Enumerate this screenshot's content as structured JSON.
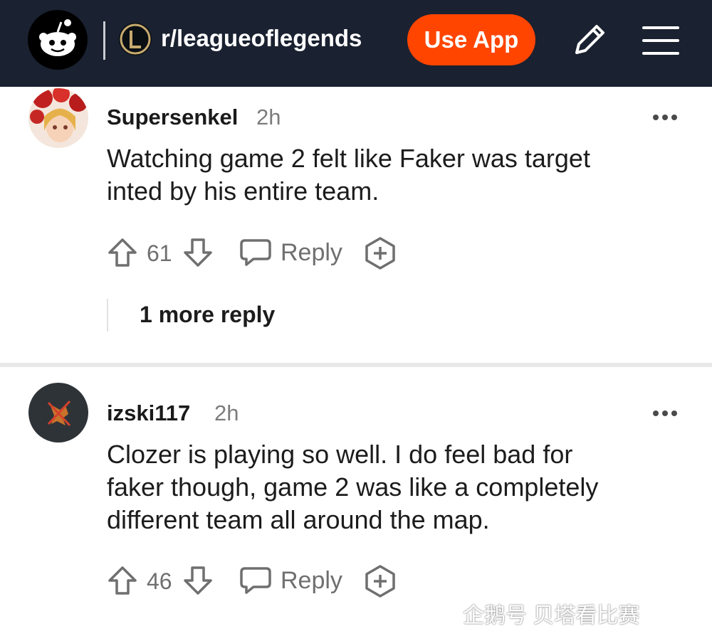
{
  "header": {
    "subreddit": "r/leagueoflegends",
    "use_app_label": "Use App",
    "icons": [
      "reddit-logo-icon",
      "league-logo-icon",
      "pencil-icon",
      "menu-icon"
    ]
  },
  "comments": [
    {
      "username": "Supersenkel",
      "time": "2h",
      "text_line1": "Watching game 2 felt like Faker was target",
      "text_line2": "inted by his entire team.",
      "score": "61",
      "reply_label": "Reply",
      "more_replies": "1 more reply"
    },
    {
      "username": "izski117",
      "time": "2h",
      "text_line1": "Clozer is playing so well. I do feel bad for",
      "text_line2": "faker though, game 2 was like a completely",
      "text_line3": "different team all around the map.",
      "score": "46",
      "reply_label": "Reply"
    }
  ],
  "watermark": "企鹅号 贝塔看比赛",
  "colors": {
    "header_bg": "#1a2130",
    "accent": "#ff4500"
  }
}
